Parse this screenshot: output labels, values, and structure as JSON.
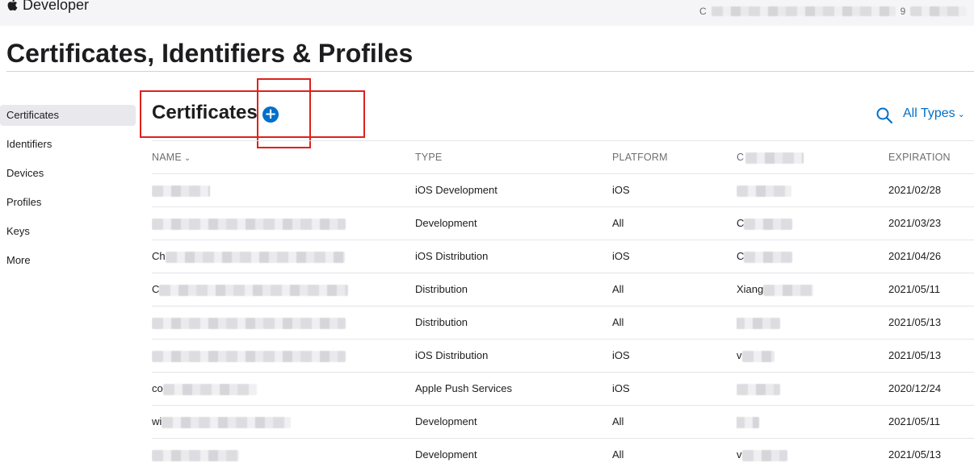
{
  "header": {
    "brand": "Developer",
    "account_prefix": "C",
    "account_suffix": "9"
  },
  "page_title": "Certificates, Identifiers & Profiles",
  "sidebar": {
    "items": [
      {
        "label": "Certificates",
        "active": true
      },
      {
        "label": "Identifiers",
        "active": false
      },
      {
        "label": "Devices",
        "active": false
      },
      {
        "label": "Profiles",
        "active": false
      },
      {
        "label": "Keys",
        "active": false
      },
      {
        "label": "More",
        "active": false
      }
    ]
  },
  "section": {
    "title": "Certificates",
    "add_label": "+",
    "filter_label": "All Types"
  },
  "table": {
    "columns": {
      "name": "NAME",
      "type": "TYPE",
      "platform": "PLATFORM",
      "created": "C",
      "expiration": "EXPIRATION"
    },
    "rows": [
      {
        "name": "",
        "type": "iOS Development",
        "platform": "iOS",
        "created": "",
        "expiration": "2021/02/28"
      },
      {
        "name": "",
        "type": "Development",
        "platform": "All",
        "created": "C",
        "expiration": "2021/03/23"
      },
      {
        "name": "Ch",
        "type": "iOS Distribution",
        "platform": "iOS",
        "created": "C",
        "expiration": "2021/04/26"
      },
      {
        "name": "C",
        "type": "Distribution",
        "platform": "All",
        "created": "Xiang",
        "expiration": "2021/05/11"
      },
      {
        "name": "",
        "type": "Distribution",
        "platform": "All",
        "created": "",
        "expiration": "2021/05/13"
      },
      {
        "name": "",
        "type": "iOS Distribution",
        "platform": "iOS",
        "created": "v",
        "expiration": "2021/05/13"
      },
      {
        "name": "co",
        "type": "Apple Push Services",
        "platform": "iOS",
        "created": "",
        "expiration": "2020/12/24"
      },
      {
        "name": "wi",
        "type": "Development",
        "platform": "All",
        "created": "",
        "expiration": "2021/05/11"
      },
      {
        "name": "",
        "type": "Development",
        "platform": "All",
        "created": "v",
        "expiration": "2021/05/13"
      }
    ]
  },
  "colors": {
    "accent": "#0070c9",
    "annotation": "#e0201b"
  }
}
